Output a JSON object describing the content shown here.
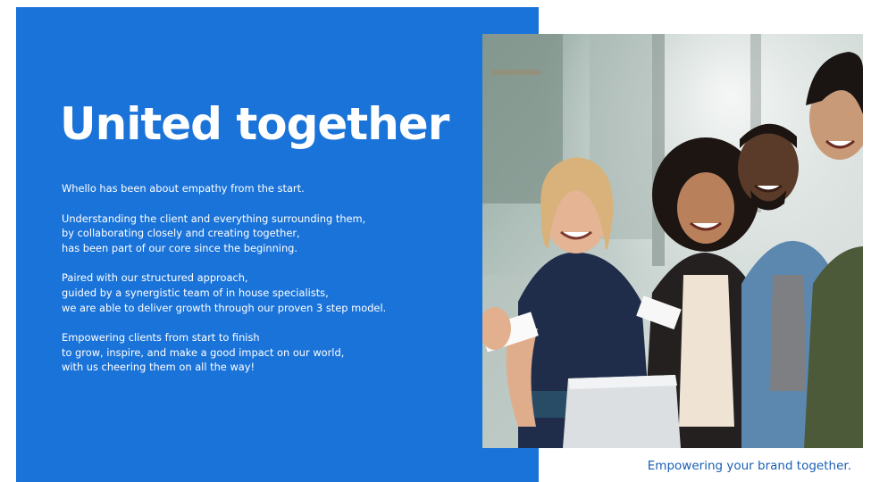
{
  "slide": {
    "headline": "United together",
    "paragraphs": [
      [
        "Whello has been about empathy from the start."
      ],
      [
        "Understanding the client and everything surrounding them,",
        "by collaborating closely and creating together,",
        "has been part of our core since the beginning."
      ],
      [
        "Paired with our structured approach,",
        "guided by a synergistic team of in house specialists,",
        "we are able to deliver growth through our proven 3 step model."
      ],
      [
        "Empowering clients from start to finish",
        "to grow, inspire, and make a good impact on our world,",
        "with us cheering them on all the way!"
      ]
    ],
    "tagline": "Empowering your brand together.",
    "colors": {
      "panel": "#1a73d9",
      "tagline": "#1a5fb4",
      "text": "#ffffff"
    }
  }
}
